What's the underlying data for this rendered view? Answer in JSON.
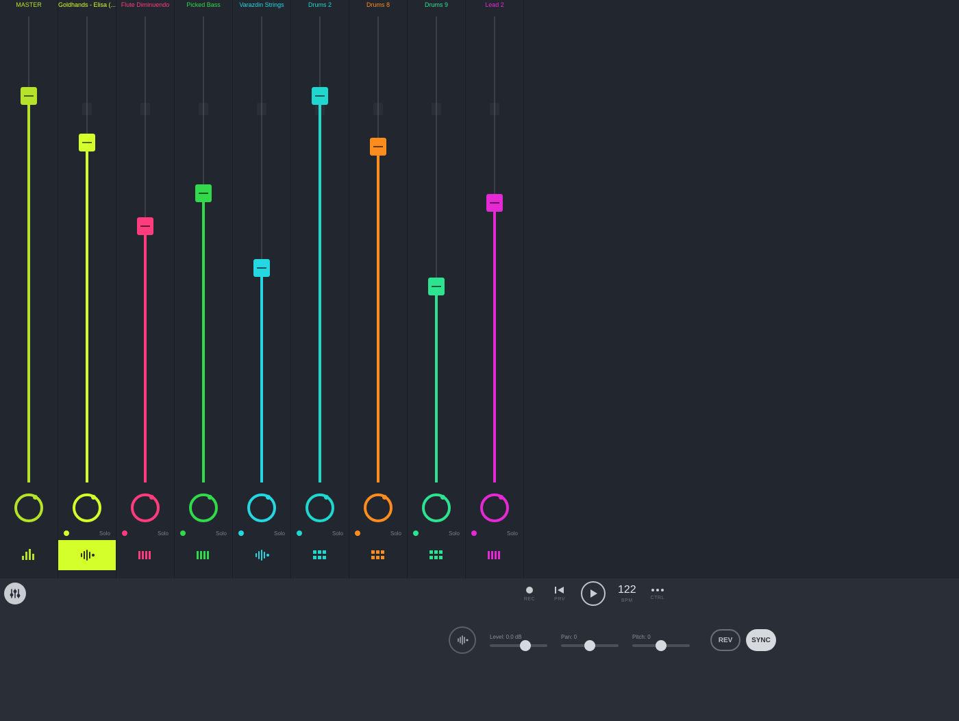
{
  "ui": {
    "solo_label": "Solo"
  },
  "tracks": [
    {
      "name": "MASTER",
      "color": "#b6e32a",
      "fader": 0.83,
      "selected": false,
      "is_master": true,
      "icon": "levels"
    },
    {
      "name": "Goldhands - Elisa (...ocal)",
      "color": "#d4ff2a",
      "fader": 0.73,
      "selected": true,
      "icon": "wave-dot"
    },
    {
      "name": "Flute Diminuendo",
      "color": "#ff3c7e",
      "fader": 0.55,
      "selected": false,
      "icon": "keys"
    },
    {
      "name": "Picked Bass",
      "color": "#31d94b",
      "fader": 0.62,
      "selected": false,
      "icon": "keys"
    },
    {
      "name": "Varazdin Strings",
      "color": "#26d6e0",
      "fader": 0.46,
      "selected": false,
      "icon": "wave-dot"
    },
    {
      "name": "Drums 2",
      "color": "#1fd7cf",
      "fader": 0.83,
      "selected": false,
      "icon": "pads"
    },
    {
      "name": "Drums 8",
      "color": "#ff8c1f",
      "fader": 0.72,
      "selected": false,
      "icon": "pads"
    },
    {
      "name": "Drums 9",
      "color": "#2de38f",
      "fader": 0.42,
      "selected": false,
      "icon": "pads"
    },
    {
      "name": "Lead 2",
      "color": "#e52ad4",
      "fader": 0.6,
      "selected": false,
      "icon": "keys"
    }
  ],
  "transport": {
    "rec_label": "REC",
    "prev_label": "PRV",
    "bpm_value": "122",
    "bpm_label": "BPM",
    "ctrl_label": "CTRL"
  },
  "selected": {
    "level_label": "Level: 0.0 dB",
    "level_pos": 0.62,
    "pan_label": "Pan: 0",
    "pan_pos": 0.5,
    "pitch_label": "Pitch: 0",
    "pitch_pos": 0.5,
    "rev_label": "REV",
    "sync_label": "SYNC"
  }
}
